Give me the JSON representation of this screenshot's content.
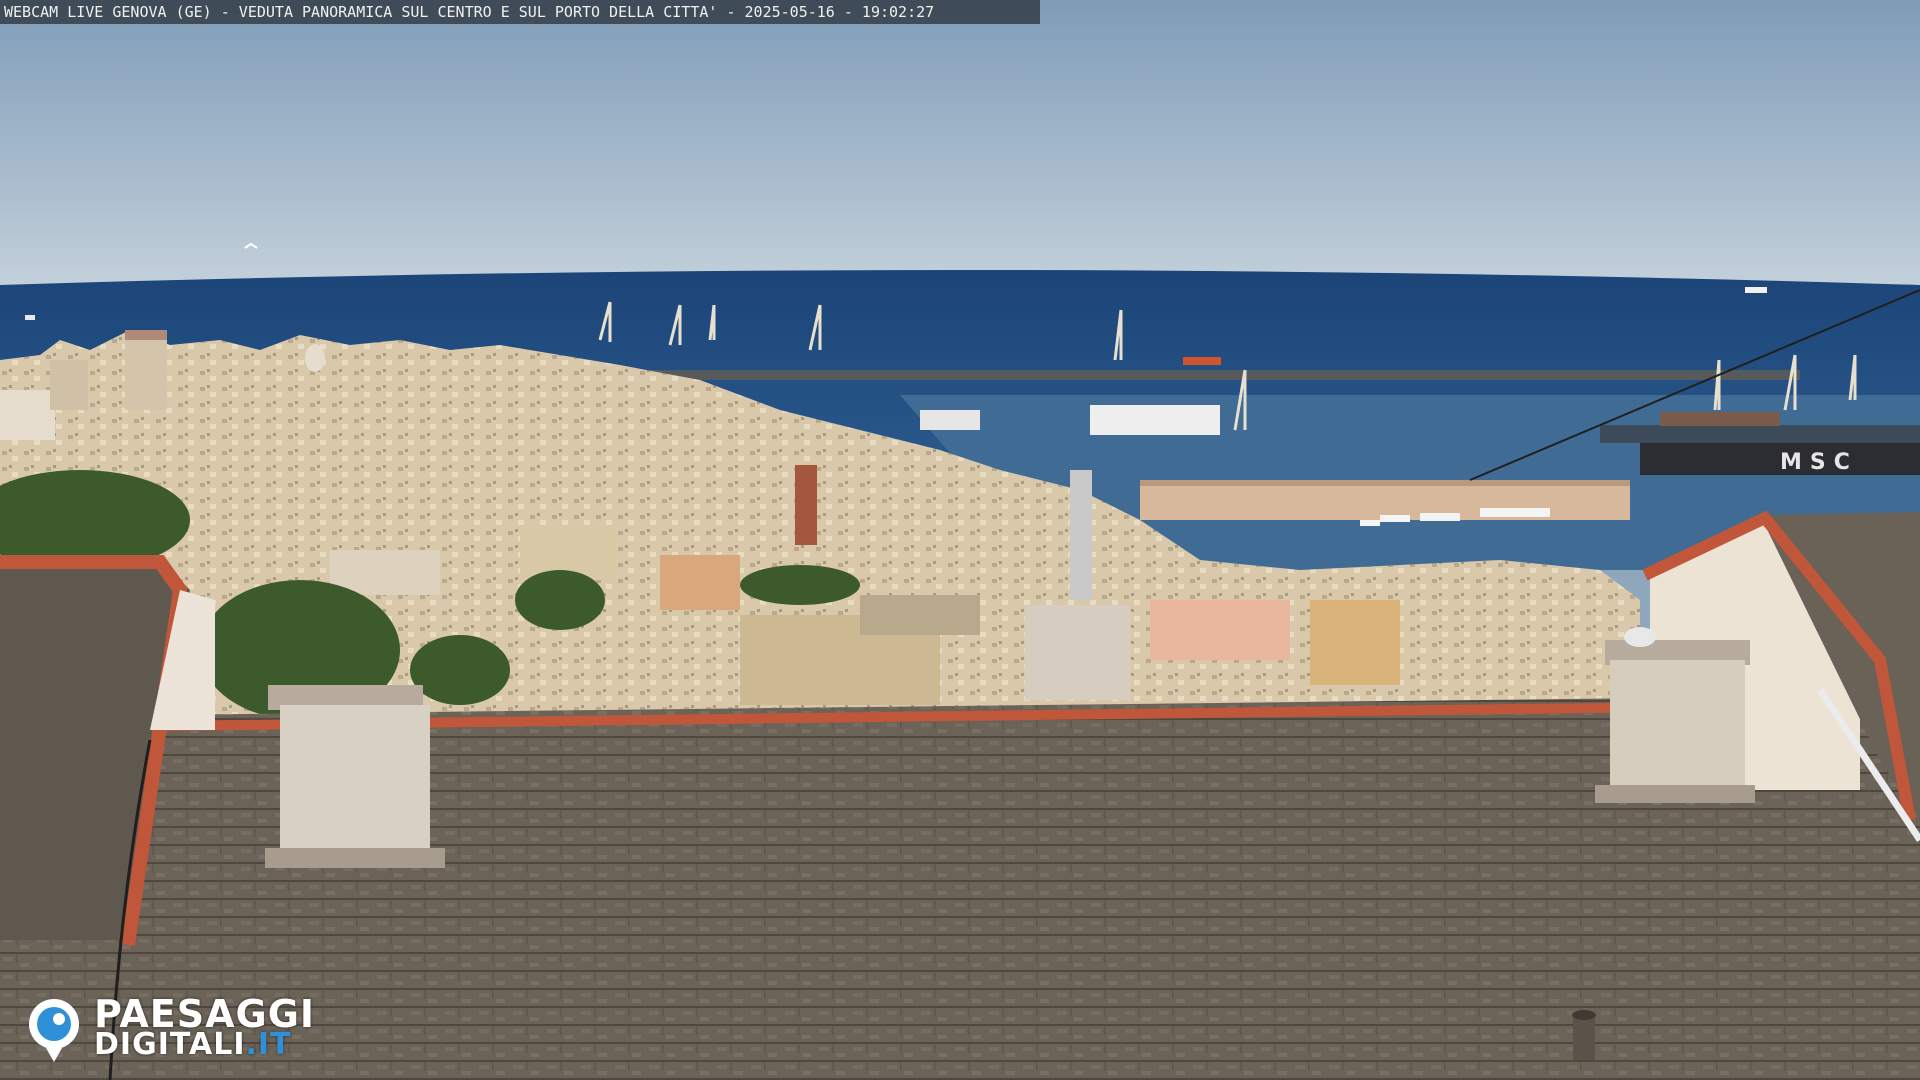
{
  "overlay": {
    "caption": "WEBCAM LIVE GENOVA (GE) - VEDUTA PANORAMICA SUL CENTRO E SUL PORTO DELLA CITTA' - 2025-05-16 - 19:02:27"
  },
  "watermark": {
    "line1": "PAESAGGI",
    "line2_main": "DIGITALI",
    "line2_accent": ".IT",
    "icon": "eye-camera-icon"
  },
  "scene": {
    "ship_lettering": "MSC",
    "colors": {
      "sky_top": "#7f9cb8",
      "sky_bottom": "#b9cbd8",
      "sea": "#1f4a7d",
      "harbor_water": "#3d6a94",
      "roof": "#6c6458",
      "roof_edge": "#c0563a",
      "city": "#d8c7a8",
      "trees": "#3f5b2c",
      "watermark_accent": "#2f8fd8"
    }
  }
}
